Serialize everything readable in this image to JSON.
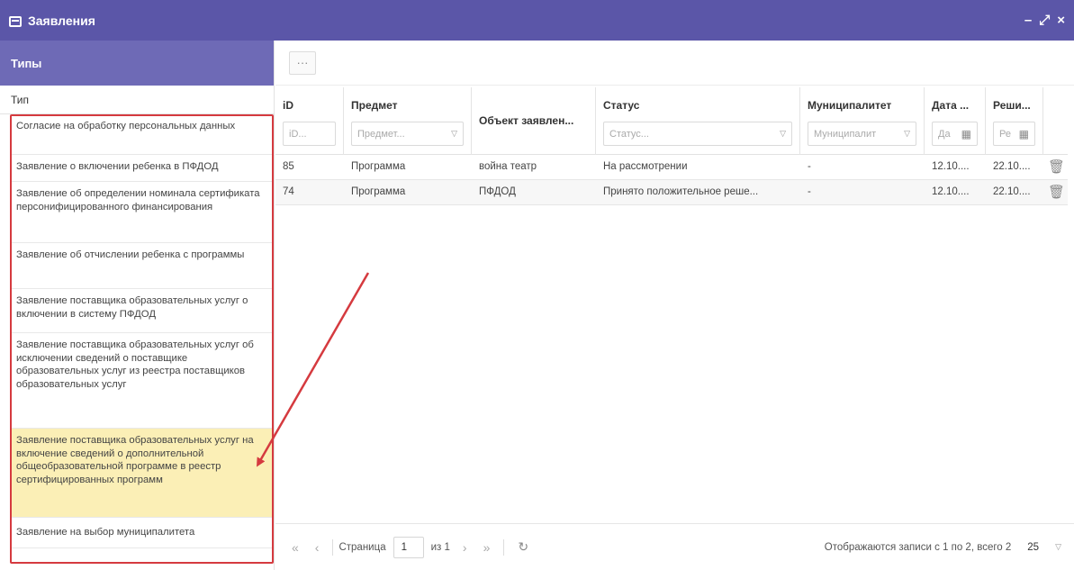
{
  "window": {
    "title": "Заявления",
    "minimize": "–",
    "maximize": "⤢",
    "close": "×"
  },
  "left": {
    "header": "Типы",
    "column": "Тип",
    "items": [
      "Согласие на обработку персональных данных",
      "Заявление о включении ребенка в ПФДОД",
      "Заявление об определении номинала сертификата персонифицированного финансирования",
      "Заявление об отчислении ребенка с программы",
      "Заявление поставщика образовательных услуг о включении в систему ПФДОД",
      "Заявление поставщика образовательных услуг об исключении сведений о поставщике образовательных услуг из реестра поставщиков образовательных услуг",
      "Заявление поставщика образовательных услуг на включение сведений о дополнительной общеобразовательной программе в реестр сертифицированных программ",
      "Заявление на выбор муниципалитета"
    ],
    "selected_index": 6
  },
  "toolbar": {
    "more": "···"
  },
  "grid": {
    "columns": {
      "id": {
        "label": "iD",
        "placeholder": "iD..."
      },
      "subject": {
        "label": "Предмет",
        "placeholder": "Предмет..."
      },
      "object": {
        "label": "Объект заявлен..."
      },
      "status": {
        "label": "Статус",
        "placeholder": "Статус..."
      },
      "municipality": {
        "label": "Муниципалитет",
        "placeholder": "Муниципалит"
      },
      "date": {
        "label": "Дата ...",
        "placeholder": "Да"
      },
      "decision": {
        "label": "Реши...",
        "placeholder": "Ре"
      }
    },
    "rows": [
      {
        "id": "85",
        "subject": "Программа",
        "object": "война театр",
        "status": "На рассмотрении",
        "municipality": "-",
        "date": "12.10....",
        "decision": "22.10...."
      },
      {
        "id": "74",
        "subject": "Программа",
        "object": "ПФДОД",
        "status": "Принято положительное реше...",
        "municipality": "-",
        "date": "12.10....",
        "decision": "22.10...."
      }
    ]
  },
  "pager": {
    "page_label": "Страница",
    "page_value": "1",
    "of_label": "из 1",
    "info": "Отображаются записи с 1 по 2, всего 2",
    "page_size": "25"
  }
}
